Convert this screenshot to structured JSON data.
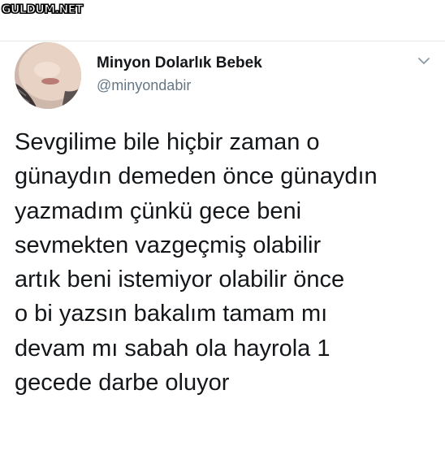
{
  "watermark": "GULDUM.NET",
  "tweet": {
    "author": {
      "display_name": "Minyon Dolarlık Bebek",
      "handle": "@minyondabir"
    },
    "menu_icon": "chevron-down-icon",
    "lines": [
      "Sevgilime bile hiçbir zaman o",
      "günaydın demeden önce günaydın",
      "yazmadım çünkü gece beni",
      "sevmekten vazgeçmiş olabilir",
      "artık beni istemiyor olabilir önce",
      "o bi yazsın bakalım tamam mı",
      "devam mı sabah ola hayrola 1",
      "gecede darbe oluyor"
    ]
  },
  "colors": {
    "text": "#14171a",
    "secondary_text": "#657786",
    "divider": "#e6e6e6"
  }
}
